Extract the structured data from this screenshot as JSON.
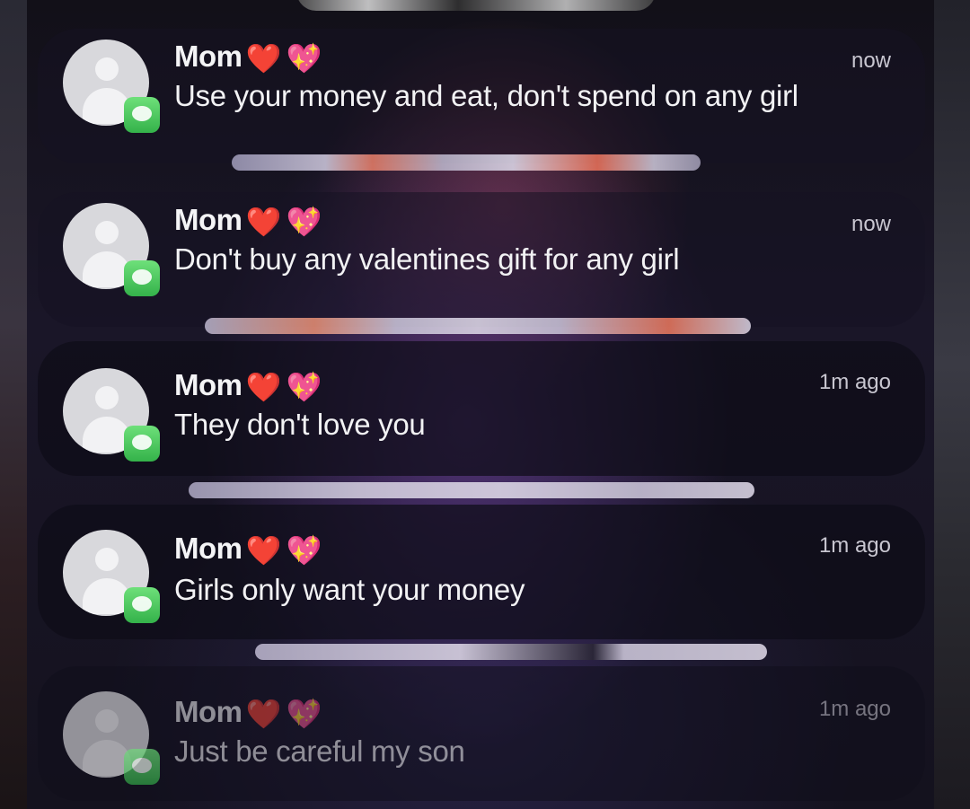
{
  "notifications": [
    {
      "sender": "Mom",
      "emoji1": "❤️",
      "emoji2": "💖",
      "message": "Use your money and eat, don't spend on any girl",
      "time": "now"
    },
    {
      "sender": "Mom",
      "emoji1": "❤️",
      "emoji2": "💖",
      "message": "Don't buy any valentines gift for any girl",
      "time": "now"
    },
    {
      "sender": "Mom",
      "emoji1": "❤️",
      "emoji2": "💖",
      "message": "They don't love you",
      "time": "1m ago"
    },
    {
      "sender": "Mom",
      "emoji1": "❤️",
      "emoji2": "💖",
      "message": "Girls only want your money",
      "time": "1m ago"
    },
    {
      "sender": "Mom",
      "emoji1": "❤️",
      "emoji2": "💖",
      "message": "Just be careful my son",
      "time": "1m ago"
    }
  ],
  "icons": {
    "avatar": "default-contact-avatar-icon",
    "app_badge": "messages-app-icon"
  },
  "colors": {
    "badge_green": "#4cc95c",
    "heart_red": "#e22a36",
    "heart_pink": "#e66cd6"
  }
}
